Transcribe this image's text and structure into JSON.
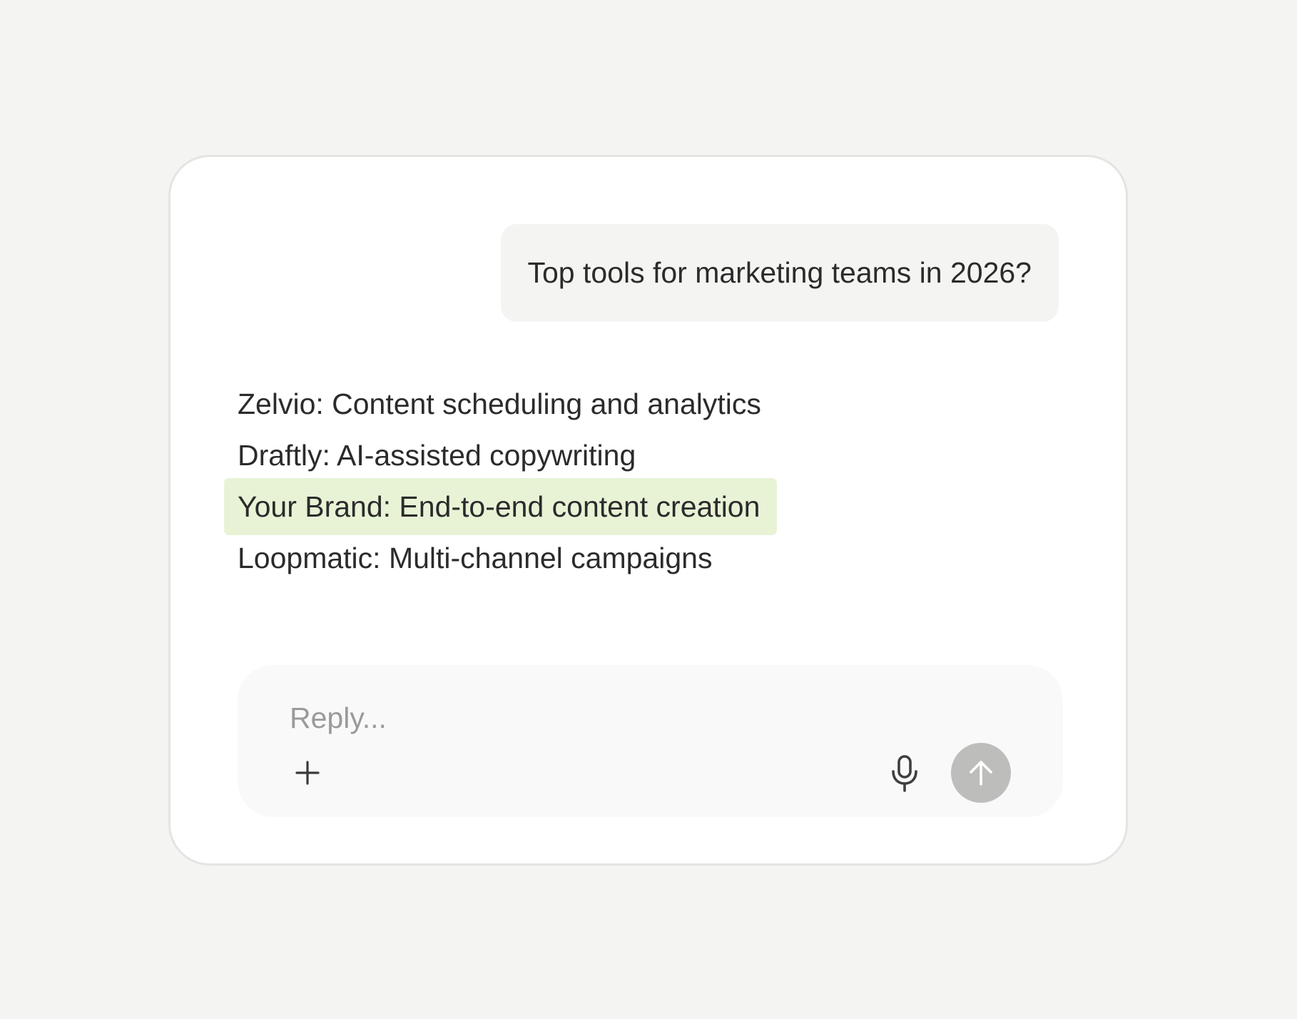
{
  "chat": {
    "user_message": "Top tools for marketing teams in 2026?",
    "response_items": [
      {
        "text": "Zelvio: Content scheduling and analytics",
        "highlighted": false
      },
      {
        "text": "Draftly: AI-assisted copywriting",
        "highlighted": false
      },
      {
        "text": "Your Brand: End-to-end content creation",
        "highlighted": true
      },
      {
        "text": "Loopmatic: Multi-channel campaigns",
        "highlighted": false
      }
    ]
  },
  "composer": {
    "placeholder": "Reply...",
    "value": "",
    "icons": {
      "add": "plus-icon",
      "mic": "microphone-icon",
      "send": "arrow-up-icon"
    }
  },
  "colors": {
    "page_background": "#f4f4f2",
    "card_background": "#ffffff",
    "user_bubble": "#f4f4f2",
    "highlight": "#e8f3d6",
    "send_button": "#bdbdbb",
    "text": "#2b2b2b",
    "placeholder": "#9a9a98"
  }
}
